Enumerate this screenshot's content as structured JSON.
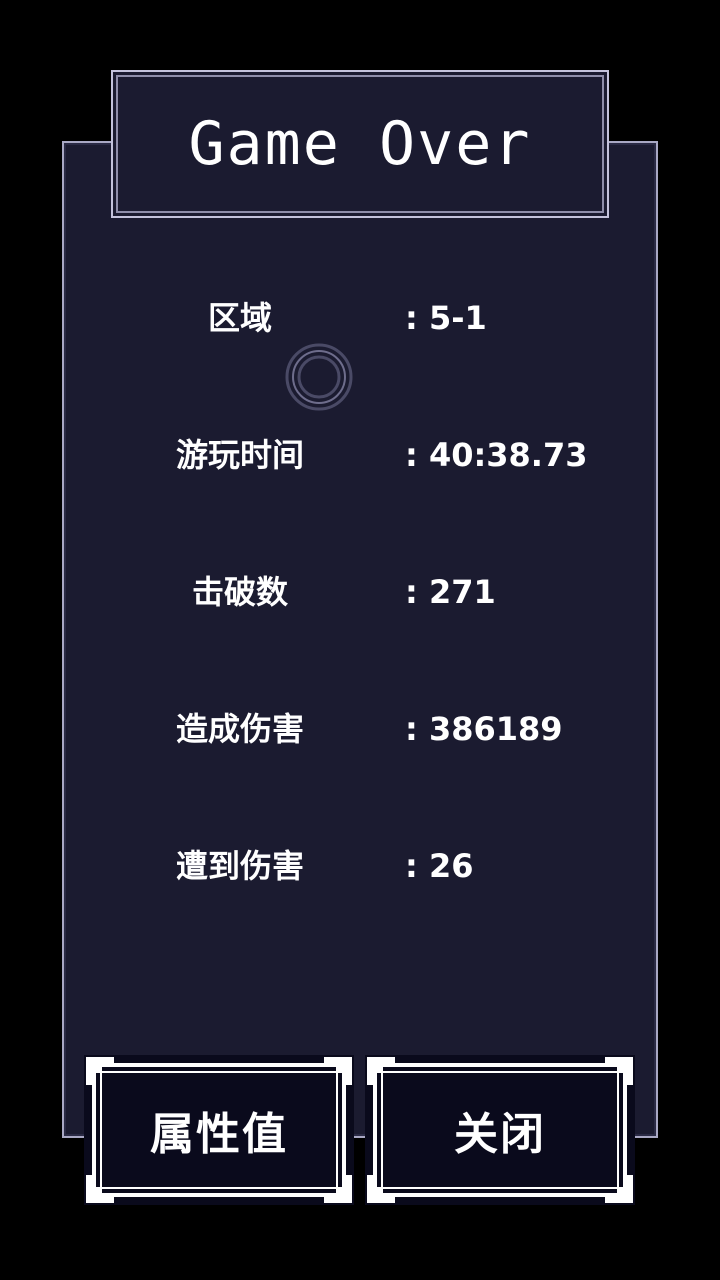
{
  "title": "Game Over",
  "stats": [
    {
      "label": "区域",
      "value": ": 5-1"
    },
    {
      "label": "游玩时间",
      "value": ": 40:38.73"
    },
    {
      "label": "击破数",
      "value": ": 271"
    },
    {
      "label": "造成伤害",
      "value": ": 386189"
    },
    {
      "label": "遭到伤害",
      "value": ": 26"
    }
  ],
  "buttons": {
    "attributes_label": "属性值",
    "close_label": "关闭"
  },
  "colors": {
    "background": "#000000",
    "panel": "#1b1b30",
    "border": "#a9a8c4",
    "text": "#ffffff",
    "button_fill": "#0a0a1c"
  }
}
